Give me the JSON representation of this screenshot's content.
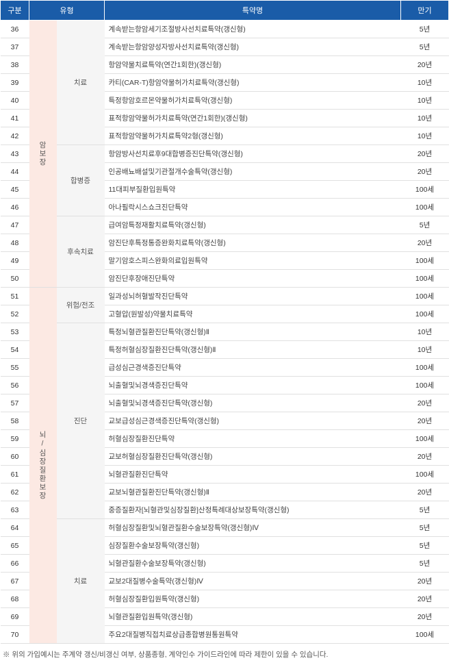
{
  "headers": {
    "col1": "구분",
    "col2": "유형",
    "col3": "특약명",
    "col4": "만기"
  },
  "cats": [
    {
      "label": "암\n보\n장",
      "span": 15
    },
    {
      "label": "뇌\n/\n심\n장\n질\n환\n보\n장",
      "span": 20
    }
  ],
  "types": [
    {
      "label": "치료",
      "span": 7
    },
    {
      "label": "합병증",
      "span": 4
    },
    {
      "label": "후속치료",
      "span": 4
    },
    {
      "label": "위험/전조",
      "span": 2
    },
    {
      "label": "진단",
      "span": 11
    },
    {
      "label": "치료",
      "span": 7
    }
  ],
  "rows": [
    {
      "n": 36,
      "name": "계속받는항암세기조절방사선치료특약(갱신형)",
      "term": "5년"
    },
    {
      "n": 37,
      "name": "계속받는항암양성자방사선치료특약(갱신형)",
      "term": "5년"
    },
    {
      "n": 38,
      "name": "항암약물치료특약(연간1회한)(갱신형)",
      "term": "20년"
    },
    {
      "n": 39,
      "name": "카티(CAR-T)항암약물허가치료특약(갱신형)",
      "term": "10년"
    },
    {
      "n": 40,
      "name": "특정항암호르몬약물허가치료특약(갱신형)",
      "term": "10년"
    },
    {
      "n": 41,
      "name": "표적항암약물허가치료특약(연간1회한)(갱신형)",
      "term": "10년"
    },
    {
      "n": 42,
      "name": "표적항암약물허가치료특약2형(갱신형)",
      "term": "10년"
    },
    {
      "n": 43,
      "name": "항암방사선치료후9대합병증진단특약(갱신형)",
      "term": "20년"
    },
    {
      "n": 44,
      "name": "인공배뇨배설및기관절개수술특약(갱신형)",
      "term": "20년"
    },
    {
      "n": 45,
      "name": "11대피부질환입원특약",
      "term": "100세"
    },
    {
      "n": 46,
      "name": "아나필락시스쇼크진단특약",
      "term": "100세"
    },
    {
      "n": 47,
      "name": "급여암특정재활치료특약(갱신형)",
      "term": "5년"
    },
    {
      "n": 48,
      "name": "암진단후특정통증완화치료특약(갱신형)",
      "term": "20년"
    },
    {
      "n": 49,
      "name": "말기암호스피스완화의료입원특약",
      "term": "100세"
    },
    {
      "n": 50,
      "name": "암진단후장애진단특약",
      "term": "100세"
    },
    {
      "n": 51,
      "name": "일과성뇌허혈발작진단특약",
      "term": "100세"
    },
    {
      "n": 52,
      "name": "고혈압(원발성)약물치료특약",
      "term": "100세"
    },
    {
      "n": 53,
      "name": "특정뇌혈관질환진단특약(갱신형)Ⅱ",
      "term": "10년"
    },
    {
      "n": 54,
      "name": "특정허혈심장질환진단특약(갱신형)Ⅱ",
      "term": "10년"
    },
    {
      "n": 55,
      "name": "급성심근경색증진단특약",
      "term": "100세"
    },
    {
      "n": 56,
      "name": "뇌출혈및뇌경색증진단특약",
      "term": "100세"
    },
    {
      "n": 57,
      "name": "뇌출혈및뇌경색증진단특약(갱신형)",
      "term": "20년"
    },
    {
      "n": 58,
      "name": "교보급성심근경색증진단특약(갱신형)",
      "term": "20년"
    },
    {
      "n": 59,
      "name": "허혈심장질환진단특약",
      "term": "100세"
    },
    {
      "n": 60,
      "name": "교보허혈심장질환진단특약(갱신형)",
      "term": "20년"
    },
    {
      "n": 61,
      "name": "뇌혈관질환진단특약",
      "term": "100세"
    },
    {
      "n": 62,
      "name": "교보뇌혈관질환진단특약(갱신형)Ⅱ",
      "term": "20년"
    },
    {
      "n": 63,
      "name": "중증질환자[뇌혈관및심장질환]산정특례대상보장특약(갱신형)",
      "term": "5년"
    },
    {
      "n": 64,
      "name": "허혈심장질환및뇌혈관질환수술보장특약(갱신형)Ⅳ",
      "term": "5년"
    },
    {
      "n": 65,
      "name": "심장질환수술보장특약(갱신형)",
      "term": "5년"
    },
    {
      "n": 66,
      "name": "뇌혈관질환수술보장특약(갱신형)",
      "term": "5년"
    },
    {
      "n": 67,
      "name": "교보2대질병수술특약(갱신형)Ⅳ",
      "term": "20년"
    },
    {
      "n": 68,
      "name": "허혈심장질환입원특약(갱신형)",
      "term": "20년"
    },
    {
      "n": 69,
      "name": "뇌혈관질환입원특약(갱신형)",
      "term": "20년"
    },
    {
      "n": 70,
      "name": "주요2대질병직접치료상급종합병원통원특약",
      "term": "100세"
    }
  ],
  "footnote": "※ 위의 가입예시는 주계약 갱신/비갱신 여부, 상품종형, 계약인수 가이드라인에 따라 제한이 있을 수 있습니다."
}
